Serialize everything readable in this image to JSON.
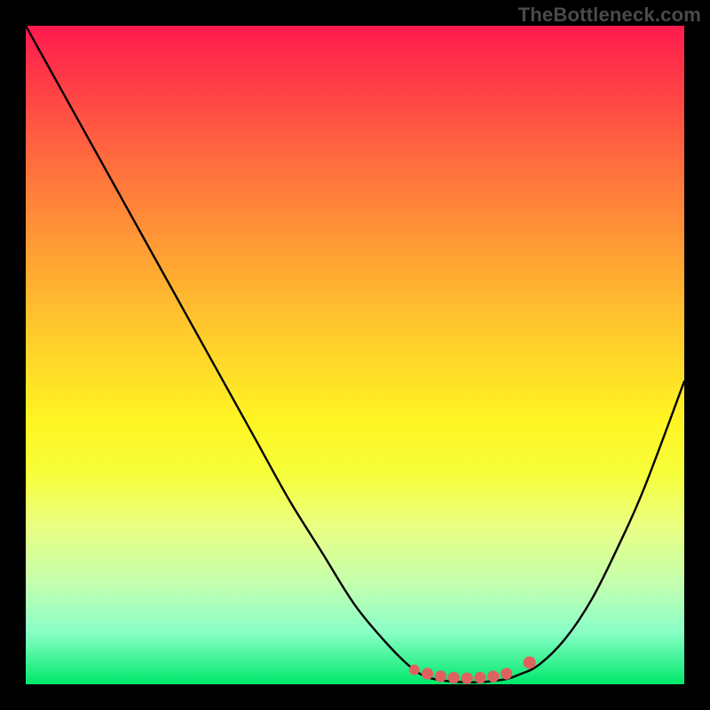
{
  "watermark": "TheBottleneck.com",
  "chart_data": {
    "type": "line",
    "title": "",
    "xlabel": "",
    "ylabel": "",
    "xlim": [
      0,
      100
    ],
    "ylim": [
      0,
      100
    ],
    "grid": false,
    "legend": false,
    "annotations": [],
    "series": [
      {
        "name": "bottleneck-curve",
        "x": [
          0,
          5,
          10,
          15,
          20,
          25,
          30,
          35,
          40,
          45,
          50,
          55,
          58,
          60,
          62,
          65,
          68,
          70,
          73,
          75,
          78,
          82,
          86,
          90,
          94,
          100
        ],
        "y": [
          100,
          91,
          82,
          73,
          64,
          55,
          46,
          37,
          28,
          20,
          12,
          6,
          3,
          1.5,
          0.8,
          0.4,
          0.3,
          0.4,
          0.8,
          1.5,
          3,
          7,
          13,
          21,
          30,
          46
        ]
      }
    ],
    "markers": [
      {
        "name": "valley-marker",
        "x": 59,
        "y": 2.2,
        "r": 2.7,
        "color": "#e0625f"
      },
      {
        "name": "valley-marker",
        "x": 61,
        "y": 1.6,
        "r": 3.0,
        "color": "#e0625f"
      },
      {
        "name": "valley-marker",
        "x": 63,
        "y": 1.2,
        "r": 3.0,
        "color": "#e0625f"
      },
      {
        "name": "valley-marker",
        "x": 65,
        "y": 1.0,
        "r": 3.0,
        "color": "#e0625f"
      },
      {
        "name": "valley-marker",
        "x": 67,
        "y": 0.9,
        "r": 3.0,
        "color": "#e0625f"
      },
      {
        "name": "valley-marker",
        "x": 69,
        "y": 1.0,
        "r": 3.0,
        "color": "#e0625f"
      },
      {
        "name": "valley-marker",
        "x": 71,
        "y": 1.2,
        "r": 3.0,
        "color": "#e0625f"
      },
      {
        "name": "valley-marker",
        "x": 73,
        "y": 1.6,
        "r": 3.0,
        "color": "#e0625f"
      },
      {
        "name": "valley-marker",
        "x": 76.5,
        "y": 3.3,
        "r": 3.2,
        "color": "#e0625f"
      }
    ],
    "background_gradient": {
      "stops": [
        {
          "pct": 0,
          "color": "#ff1a4d"
        },
        {
          "pct": 8,
          "color": "#ff3a47"
        },
        {
          "pct": 20,
          "color": "#ff6a3e"
        },
        {
          "pct": 33,
          "color": "#ff9a35"
        },
        {
          "pct": 46,
          "color": "#ffc92c"
        },
        {
          "pct": 60,
          "color": "#fff423"
        },
        {
          "pct": 68,
          "color": "#f6ff3a"
        },
        {
          "pct": 76,
          "color": "#eaff82"
        },
        {
          "pct": 85,
          "color": "#c2ffb0"
        },
        {
          "pct": 92,
          "color": "#8affc8"
        },
        {
          "pct": 100,
          "color": "#00e86b"
        }
      ]
    },
    "curve_color": "#000000",
    "curve_width": 2.4
  }
}
